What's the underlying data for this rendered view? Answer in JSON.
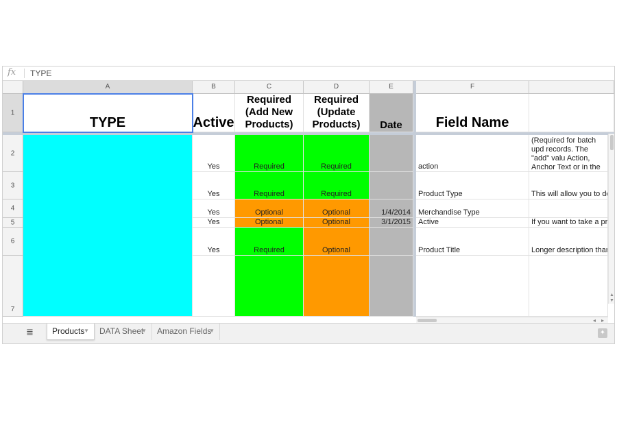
{
  "formula_bar": {
    "fx_label": "fx",
    "value": "TYPE"
  },
  "columns": [
    "A",
    "B",
    "C",
    "D",
    "E",
    "F"
  ],
  "rows": [
    "1",
    "2",
    "3",
    "4",
    "5",
    "6",
    "7"
  ],
  "colors": {
    "cyan": "#00ffff",
    "green": "#00ff00",
    "orange": "#ff9900",
    "gray": "#b7b7b7",
    "selection": "#4a7fe6"
  },
  "header_row": {
    "type": "TYPE",
    "active": "Active",
    "req_add": "Required (Add New Products)",
    "req_update": "Required (Update Products)",
    "date": "Date",
    "field_name": "Field Name"
  },
  "data_rows": [
    {
      "active": "Yes",
      "c": "Required",
      "d": "Required",
      "e": "",
      "f": "action",
      "g": "(Required for batch upd records. The \"add\" valu Action, Anchor Text or in the field"
    },
    {
      "active": "Yes",
      "c": "Required",
      "d": "Required",
      "e": "",
      "f": "Product Type",
      "g": "This will allow you to de"
    },
    {
      "active": "Yes",
      "c": "Optional",
      "d": "Optional",
      "e": "1/4/2014",
      "f": "Merchandise Type",
      "g": ""
    },
    {
      "active": "Yes",
      "c": "Optional",
      "d": "Optional",
      "e": "3/1/2015",
      "f": "Active",
      "g": "If you want to take a pr"
    },
    {
      "active": "Yes",
      "c": "Required",
      "d": "Optional",
      "e": "",
      "f": "Product Title",
      "g": "Longer description than"
    },
    {
      "active": "",
      "c": "",
      "d": "",
      "e": "",
      "f": "",
      "g": ""
    }
  ],
  "tabs": [
    {
      "label": "Products"
    },
    {
      "label": "DATA Sheet"
    },
    {
      "label": "Amazon Fields"
    }
  ]
}
